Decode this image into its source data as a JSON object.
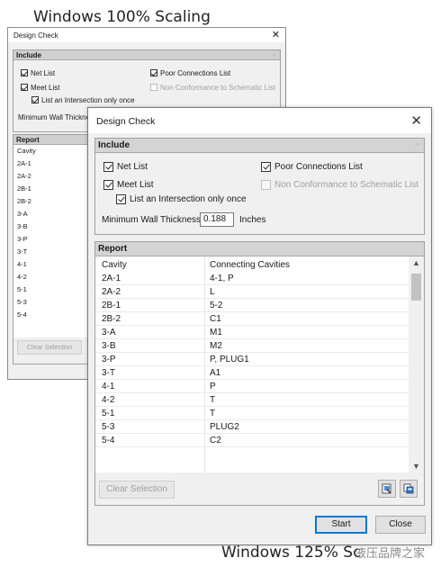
{
  "captions": {
    "top": "Windows 100% Scaling",
    "bottom": "Windows 125% Sc",
    "watermark": "液压品牌之家"
  },
  "small_dialog": {
    "title": "Design Check",
    "close": "✕",
    "include_header": "Include",
    "net_list": "Net List",
    "meet_list": "Meet List",
    "intersection_once": "List an Intersection only once",
    "poor_connections": "Poor Connections List",
    "non_conformance": "Non Conformance to Schematic List",
    "min_wall": "Minimum Wall Thicknes",
    "report_header": "Report",
    "cavity_header": "Cavity",
    "cavities": [
      "2A-1",
      "2A-2",
      "2B-1",
      "2B-2",
      "3-A",
      "3-B",
      "3-P",
      "3-T",
      "4-1",
      "4-2",
      "5-1",
      "5-3",
      "5-4"
    ],
    "clear_selection": "Clear Selection"
  },
  "dialog": {
    "title": "Design Check",
    "close": "✕",
    "include": {
      "header": "Include",
      "net_list": "Net List",
      "meet_list": "Meet List",
      "intersection_once": "List an Intersection only once",
      "poor_connections": "Poor Connections List",
      "non_conformance": "Non Conformance to Schematic List",
      "min_wall_label": "Minimum Wall Thickness",
      "min_wall_value": "0.188",
      "min_wall_unit": "Inches"
    },
    "report": {
      "header": "Report",
      "columns": [
        "Cavity",
        "Connecting Cavities"
      ],
      "rows": [
        [
          "2A-1",
          "4-1, P"
        ],
        [
          "2A-2",
          "L"
        ],
        [
          "2B-1",
          "5-2"
        ],
        [
          "2B-2",
          "C1"
        ],
        [
          "3-A",
          "M1"
        ],
        [
          "3-B",
          "M2"
        ],
        [
          "3-P",
          "P, PLUG1"
        ],
        [
          "3-T",
          "A1"
        ],
        [
          "4-1",
          "P"
        ],
        [
          "4-2",
          "T"
        ],
        [
          "5-1",
          "T"
        ],
        [
          "5-3",
          "PLUG2"
        ],
        [
          "5-4",
          "C2"
        ]
      ]
    },
    "buttons": {
      "clear_selection": "Clear Selection",
      "start": "Start",
      "close": "Close"
    }
  }
}
